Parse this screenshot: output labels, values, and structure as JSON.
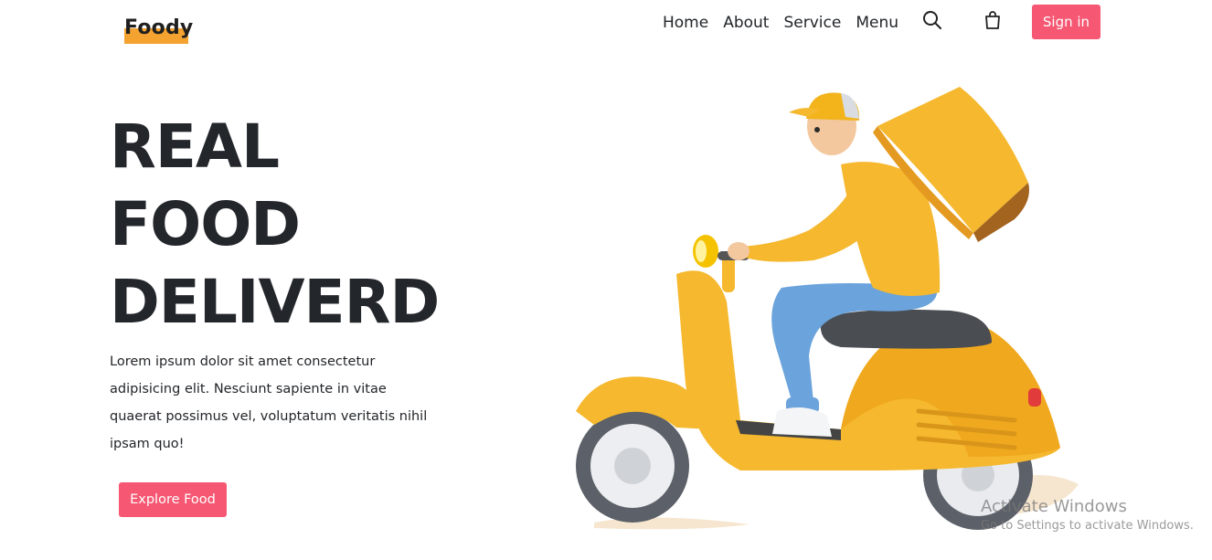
{
  "brand": {
    "name": "Foody"
  },
  "nav": {
    "items": [
      {
        "label": "Home"
      },
      {
        "label": "About"
      },
      {
        "label": "Service"
      },
      {
        "label": "Menu"
      }
    ],
    "signin_label": "Sign in"
  },
  "icons": {
    "search": "search-icon",
    "cart": "shopping-bag-icon"
  },
  "hero": {
    "title_lines": [
      "REAL",
      "FOOD",
      "DELIVERD"
    ],
    "description": "Lorem ipsum dolor sit amet consectetur adipisicing elit. Nesciunt sapiente in vitae quaerat possimus vel, voluptatum veritatis nihil ipsam quo!",
    "cta_label": "Explore Food"
  },
  "watermark": {
    "title": "Activate Windows",
    "subtitle": "Go to Settings to activate Windows."
  },
  "colors": {
    "accent": "#f65772",
    "logo_highlight": "#f4a330",
    "text": "#222529",
    "scooter": "#f5b82e"
  }
}
